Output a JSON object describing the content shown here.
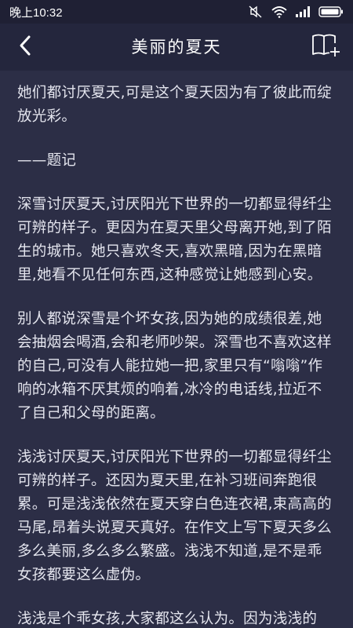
{
  "status_bar": {
    "time": "晚上10:32"
  },
  "nav": {
    "title": "美丽的夏天"
  },
  "article": {
    "paragraphs": [
      "她们都讨厌夏天,可是这个夏天因为有了彼此而绽放光彩。",
      "——题记",
      "深雪讨厌夏天,讨厌阳光下世界的一切都显得纤尘可辨的样子。更因为在夏天里父母离开她,到了陌生的城市。她只喜欢冬天,喜欢黑暗,因为在黑暗里,她看不见任何东西,这种感觉让她感到心安。",
      "别人都说深雪是个坏女孩,因为她的成绩很差,她会抽烟会喝酒,会和老师吵架。深雪也不喜欢这样的自己,可没有人能拉她一把,家里只有“嗡嗡”作响的冰箱不厌其烦的响着,冰冷的电话线,拉近不了自己和父母的距离。",
      "浅浅讨厌夏天,讨厌阳光下世界的一切都显得纤尘可辨的样子。还因为夏天里,在补习班间奔跑很累。可是浅浅依然在夏天穿白色连衣裙,束高高的马尾,昂着头说夏天真好。在作文上写下夏天多么多么美丽,多么多么繁盛。浅浅不知道,是不是乖女孩都要这么虚伪。",
      "浅浅是个乖女孩,大家都这么认为。因为浅浅的"
    ]
  },
  "icons": {
    "back": "chevron-left-icon",
    "bookmark": "book-add-icon",
    "mute": "mute-icon",
    "wifi": "wifi-icon",
    "signal": "signal-icon",
    "battery": "battery-icon"
  },
  "colors": {
    "background": "#2c2e46",
    "nav_background": "#24263d",
    "status_background": "#1f2034",
    "text": "#e4e5ee"
  }
}
